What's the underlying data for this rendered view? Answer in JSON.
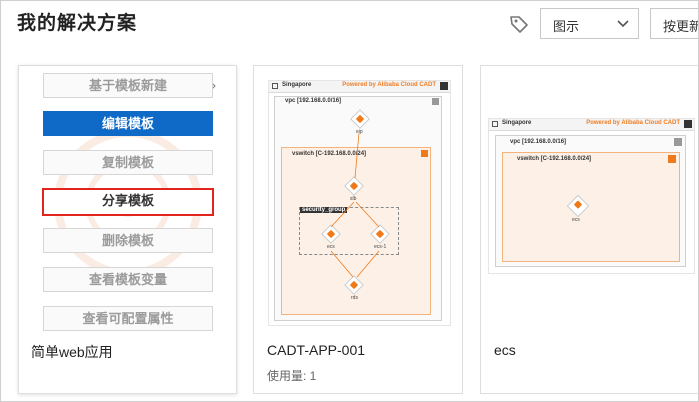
{
  "header": {
    "title": "我的解决方案",
    "view_select": "图示",
    "sort_button": "按更新"
  },
  "cards": [
    {
      "name": "简单web应用",
      "menu": [
        {
          "label": "基于模板新建"
        },
        {
          "label": "编辑模板"
        },
        {
          "label": "复制模板"
        },
        {
          "label": "分享模板"
        },
        {
          "label": "删除模板"
        },
        {
          "label": "查看模板变量"
        },
        {
          "label": "查看可配置属性"
        }
      ]
    },
    {
      "name": "CADT-APP-001",
      "usage": "使用量: 1",
      "diagram": {
        "region": "Singapore",
        "powered": "Powered by Alibaba Cloud CADT",
        "vpc": "vpc [192.168.0.0/16]",
        "vswitch": "vswitch [C-192.168.0.0/24]",
        "security_group": "security_group",
        "nodes": [
          "eip",
          "slb",
          "ecs",
          "ecs-1",
          "rds"
        ]
      }
    },
    {
      "name": "ecs",
      "diagram": {
        "region": "Singapore",
        "powered": "Powered by Alibaba Cloud CADT",
        "vpc": "vpc [192.168.0.0/16]",
        "vswitch": "vswitch [C-192.168.0.0/24]",
        "nodes": [
          "ecs"
        ]
      }
    }
  ],
  "colors": {
    "primary": "#0e6ac6",
    "highlight_border": "#e2241c",
    "diagram_accent": "#f07a1a"
  }
}
